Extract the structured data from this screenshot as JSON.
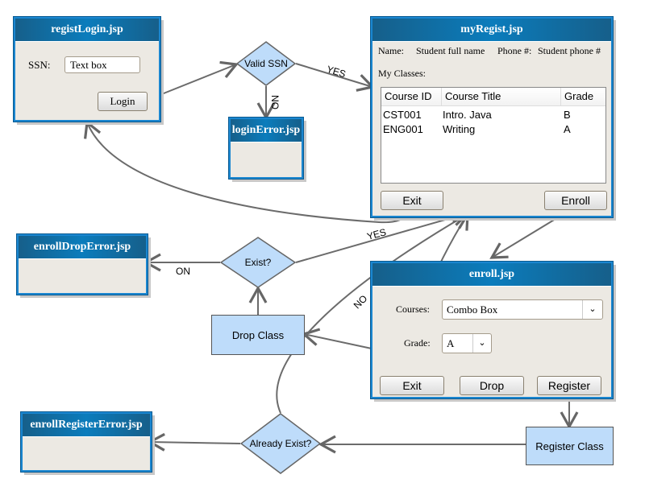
{
  "registLogin": {
    "title": "registLogin.jsp",
    "ssn_label": "SSN:",
    "ssn_value": "Text box",
    "login": "Login"
  },
  "loginError": {
    "title": "loginError.jsp"
  },
  "myRegist": {
    "title": "myRegist.jsp",
    "name_label": "Name:",
    "name_value": "Student full name",
    "phone_label": "Phone #:",
    "phone_value": "Student phone #",
    "classes_label": "My Classes:",
    "columns": [
      "Course ID",
      "Course Title",
      "Grade"
    ],
    "rows": [
      [
        "CST001",
        "Intro. Java",
        "B"
      ],
      [
        "ENG001",
        "Writing",
        "A"
      ]
    ],
    "exit": "Exit",
    "enroll": "Enroll"
  },
  "enrollDropError": {
    "title": "enrollDropError.jsp"
  },
  "enroll": {
    "title": "enroll.jsp",
    "courses_label": "Courses:",
    "courses_value": "Combo Box",
    "grade_label": "Grade:",
    "grade_value": "A",
    "exit": "Exit",
    "drop": "Drop",
    "register": "Register"
  },
  "enrollRegisterError": {
    "title": "enrollRegisterError.jsp"
  },
  "decisions": {
    "valid_ssn": "Valid SSN",
    "exist": "Exist?",
    "already_exist": "Already Exist?"
  },
  "processes": {
    "drop_class": "Drop Class",
    "register_class": "Register Class"
  },
  "labels": {
    "yes1": "YES",
    "no1": "NO",
    "yes2": "YES",
    "on": "ON",
    "no2": "NO"
  },
  "colors": {
    "header": "#0b7cbc",
    "decision_fill": "#bedcfa",
    "window_bg": "#ece9e3"
  }
}
